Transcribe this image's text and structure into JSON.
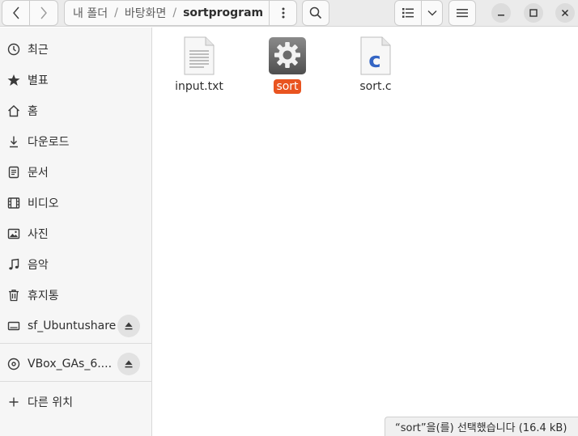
{
  "header": {
    "breadcrumbs": [
      "내 폴더",
      "바탕화면",
      "sortprogram"
    ],
    "separator": "/"
  },
  "sidebar": {
    "items": [
      {
        "label": "최근",
        "icon": "clock-icon"
      },
      {
        "label": "별표",
        "icon": "star-icon"
      },
      {
        "label": "홈",
        "icon": "home-icon"
      },
      {
        "label": "다운로드",
        "icon": "download-icon"
      },
      {
        "label": "문서",
        "icon": "document-icon"
      },
      {
        "label": "비디오",
        "icon": "film-icon"
      },
      {
        "label": "사진",
        "icon": "picture-icon"
      },
      {
        "label": "음악",
        "icon": "music-icon"
      },
      {
        "label": "휴지통",
        "icon": "trash-icon"
      }
    ],
    "drives": [
      {
        "label": "sf_Ubuntushare",
        "icon": "drive-icon"
      },
      {
        "label": "VBox_GAs_6....",
        "icon": "disc-icon"
      }
    ],
    "other_locations": "다른 위치"
  },
  "files": [
    {
      "name": "input.txt",
      "icon": "text-file-icon",
      "selected": false
    },
    {
      "name": "sort",
      "icon": "executable-gear-icon",
      "selected": true
    },
    {
      "name": "sort.c",
      "icon": "c-source-file-icon",
      "selected": false
    }
  ],
  "status": "“sort”을(를) 선택했습니다 (16.4 kB)",
  "colors": {
    "accent": "#e95420"
  }
}
